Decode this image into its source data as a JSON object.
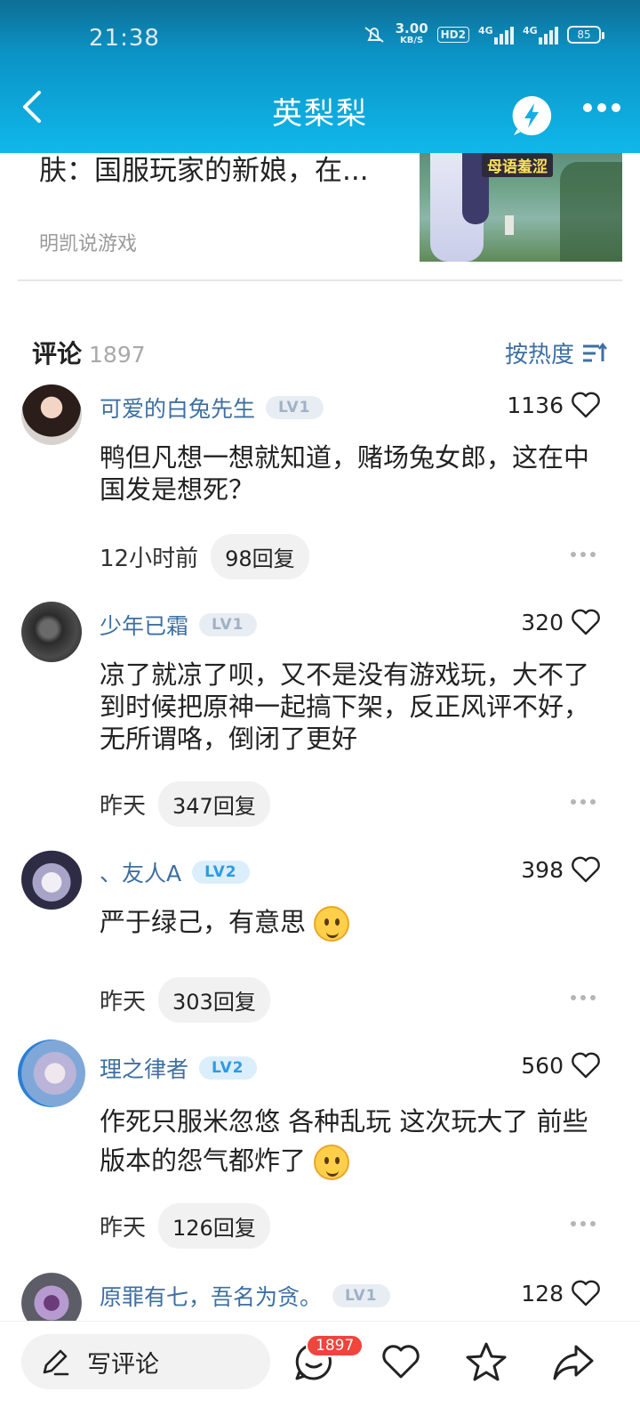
{
  "status_bar": {
    "time": "21:38",
    "net_speed_value": "3.00",
    "net_speed_unit": "KB/S",
    "hd_label": "HD2",
    "sim1_label": "4G",
    "sim2_label": "4G",
    "battery_level": "85"
  },
  "nav": {
    "title": "英梨梨",
    "icons": [
      "back-arrow-icon",
      "bolt-bubble-icon",
      "more-icon"
    ]
  },
  "article": {
    "title": "肤：国服玩家的新娘，在...",
    "source": "明凯说游戏",
    "thumb_caption": "母语羞涩"
  },
  "comments_header": {
    "label": "评论",
    "count": "1897",
    "sort_label": "按热度"
  },
  "comments": [
    {
      "name": "可爱的白兔先生",
      "level": "LV1",
      "likes": "1136",
      "text": "鸭但凡想一想就知道，赌场兔女郎，这在中国发是想死？",
      "time": "12小时前",
      "replies": "98回复"
    },
    {
      "name": "少年已霜",
      "level": "LV1",
      "likes": "320",
      "text": "凉了就凉了呗，又不是没有游戏玩，大不了到时候把原神一起搞下架，反正风评不好，无所谓咯，倒闭了更好",
      "time": "昨天",
      "replies": "347回复"
    },
    {
      "name": "、友人A",
      "level": "LV2",
      "likes": "398",
      "text": "严于绿己，有意思",
      "time": "昨天",
      "replies": "303回复"
    },
    {
      "name": "理之律者",
      "level": "LV2",
      "likes": "560",
      "text": "作死只服米忽悠 各种乱玩 这次玩大了 前些版本的怨气都炸了",
      "time": "昨天",
      "replies": "126回复"
    },
    {
      "name": "原罪有七，吾名为贪。",
      "level": "LV1",
      "likes": "128"
    }
  ],
  "bottom_bar": {
    "compose_label": "写评论",
    "comment_badge": "1897",
    "icons": [
      "pencil-icon",
      "comment-icon",
      "heart-icon",
      "star-icon",
      "share-icon"
    ]
  },
  "colors": {
    "header_top": "#0e6f96",
    "header_bottom": "#10b8ea",
    "username": "#3e6fa3",
    "badge_red": "#f0443c"
  }
}
